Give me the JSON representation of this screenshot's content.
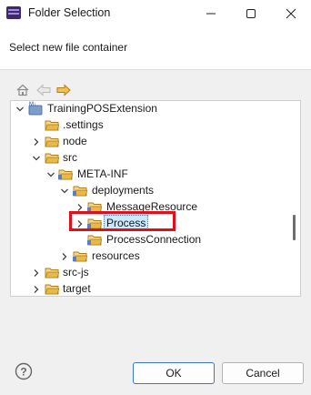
{
  "window": {
    "title": "Folder Selection"
  },
  "header": {
    "message": "Select new file container"
  },
  "tree": [
    {
      "label": "TrainingPOSExtension",
      "type": "project",
      "expanded": true
    },
    {
      "label": ".settings",
      "type": "folder"
    },
    {
      "label": "node",
      "type": "folder",
      "expanded": false
    },
    {
      "label": "src",
      "type": "folder",
      "expanded": true
    },
    {
      "label": "META-INF",
      "type": "package-folder",
      "expanded": true
    },
    {
      "label": "deployments",
      "type": "package-folder",
      "expanded": true
    },
    {
      "label": "MessageResource",
      "type": "package-folder",
      "expanded": false
    },
    {
      "label": "Process",
      "type": "package-folder",
      "expanded": false,
      "selected": true
    },
    {
      "label": "ProcessConnection",
      "type": "package-folder"
    },
    {
      "label": "resources",
      "type": "package-folder",
      "expanded": false
    },
    {
      "label": "src-js",
      "type": "folder",
      "expanded": false
    },
    {
      "label": "target",
      "type": "folder",
      "expanded": false
    }
  ],
  "buttons": {
    "ok": "OK",
    "cancel": "Cancel"
  },
  "colors": {
    "highlight": "#e0101a",
    "selection": "#cce8ff",
    "folder": "#e8b84a"
  }
}
